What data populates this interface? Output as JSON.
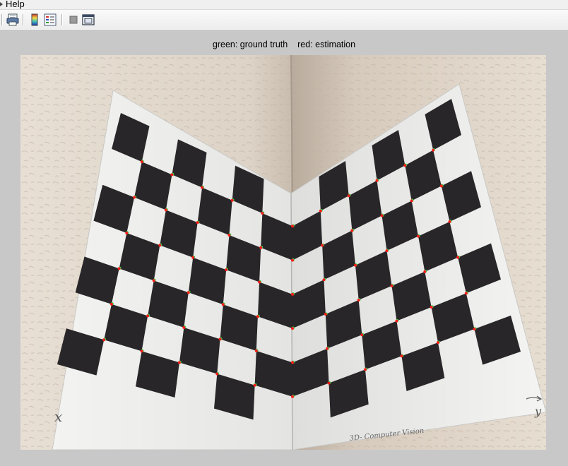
{
  "menu": {
    "help_label": "Help"
  },
  "toolbar": {
    "buttons": [
      {
        "icon": "print-preview-icon"
      },
      {
        "icon": "colorbar-icon"
      },
      {
        "icon": "legend-icon"
      },
      {
        "icon": "hide-plot-tools-icon"
      },
      {
        "icon": "show-plot-tools-icon"
      }
    ]
  },
  "figure": {
    "caption": "green: ground truth    red: estimation",
    "handwriting": {
      "x_axis": "x",
      "y_axis": "y",
      "footer": "3D- Computer Vision"
    },
    "colors": {
      "ground_truth": "#2ee04a",
      "estimation": "#ff1a1a",
      "square": "#282628",
      "paper": "#ececea",
      "wall": "#e6ddd2"
    }
  }
}
